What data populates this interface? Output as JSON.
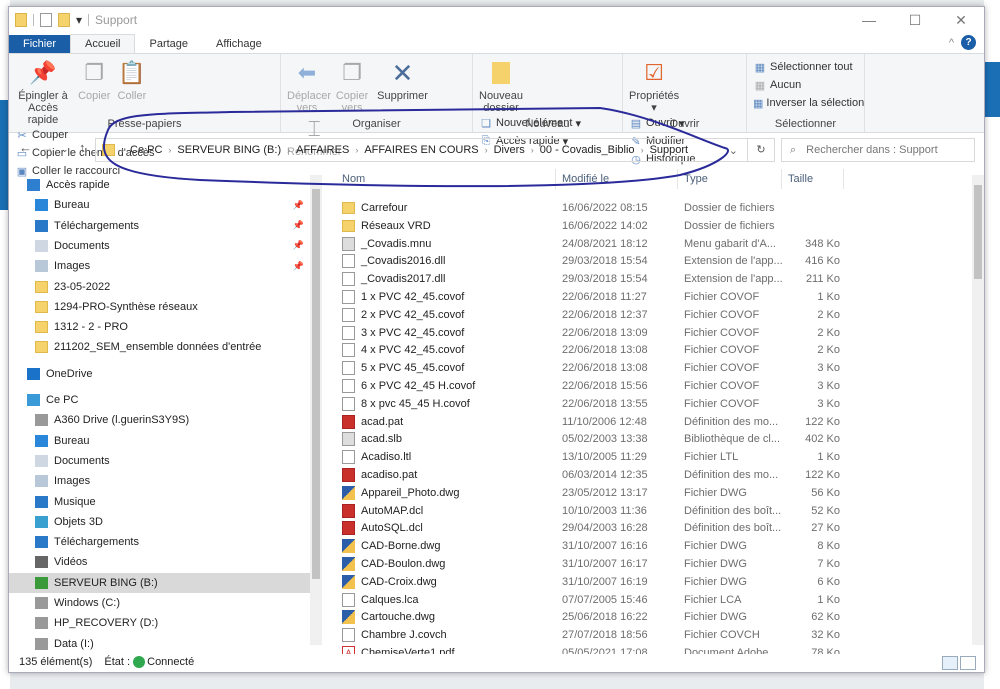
{
  "window": {
    "title": "Support",
    "controls": [
      "minimize",
      "maximize",
      "close"
    ]
  },
  "tabs": [
    "Fichier",
    "Accueil",
    "Partage",
    "Affichage"
  ],
  "active_tab": "Accueil",
  "ribbon": {
    "clipboard": {
      "label": "Presse-papiers",
      "pin": "Épingler à Accès rapide",
      "copy": "Copier",
      "paste": "Coller",
      "cut": "Couper",
      "copy_path": "Copier le chemin d'accès",
      "paste_shortcut": "Coller le raccourci"
    },
    "organize": {
      "label": "Organiser",
      "move": "Déplacer vers",
      "copy_to": "Copier vers",
      "delete": "Supprimer",
      "rename": "Renommer"
    },
    "new": {
      "label": "Nouveau",
      "new_folder": "Nouveau dossier",
      "new_item": "Nouvel élément",
      "easy_access": "Accès rapide"
    },
    "open": {
      "label": "Ouvrir",
      "properties": "Propriétés",
      "open": "Ouvrir",
      "edit": "Modifier",
      "history": "Historique"
    },
    "select": {
      "label": "Sélectionner",
      "all": "Sélectionner tout",
      "none": "Aucun",
      "invert": "Inverser la sélection"
    }
  },
  "address": {
    "crumbs": [
      "Ce PC",
      "SERVEUR BING (B:)",
      "AFFAIRES",
      "AFFAIRES EN COURS",
      "Divers",
      "00 - Covadis_Biblio",
      "Support"
    ],
    "search_placeholder": "Rechercher dans : Support"
  },
  "nav": [
    {
      "label": "Accès rapide",
      "icon": "star-icon",
      "level": 0
    },
    {
      "label": "Bureau",
      "icon": "desktop-icon",
      "level": 1,
      "pinned": true
    },
    {
      "label": "Téléchargements",
      "icon": "download-icon",
      "level": 1,
      "pinned": true
    },
    {
      "label": "Documents",
      "icon": "documents-icon",
      "level": 1,
      "pinned": true
    },
    {
      "label": "Images",
      "icon": "images-icon",
      "level": 1,
      "pinned": true
    },
    {
      "label": "23-05-2022",
      "icon": "folder-icon",
      "level": 1
    },
    {
      "label": "1294-PRO-Synthèse réseaux",
      "icon": "folder-icon",
      "level": 1
    },
    {
      "label": "1312 - 2 - PRO",
      "icon": "folder-icon",
      "level": 1
    },
    {
      "label": "211202_SEM_ensemble données d'entrée",
      "icon": "folder-icon",
      "level": 1
    },
    {
      "label": "OneDrive",
      "icon": "cloud-icon",
      "level": 0
    },
    {
      "label": "Ce PC",
      "icon": "pc-icon",
      "level": 0
    },
    {
      "label": "A360 Drive (l.guerinS3Y9S)",
      "icon": "drive-icon",
      "level": 1
    },
    {
      "label": "Bureau",
      "icon": "desktop-icon",
      "level": 1
    },
    {
      "label": "Documents",
      "icon": "documents-icon",
      "level": 1
    },
    {
      "label": "Images",
      "icon": "images-icon",
      "level": 1
    },
    {
      "label": "Musique",
      "icon": "music-icon",
      "level": 1
    },
    {
      "label": "Objets 3D",
      "icon": "3d-objects-icon",
      "level": 1
    },
    {
      "label": "Téléchargements",
      "icon": "download-icon",
      "level": 1
    },
    {
      "label": "Vidéos",
      "icon": "video-icon",
      "level": 1
    },
    {
      "label": "SERVEUR BING (B:)",
      "icon": "network-drive-icon",
      "level": 1,
      "selected": true
    },
    {
      "label": "Windows  (C:)",
      "icon": "drive-icon",
      "level": 1
    },
    {
      "label": "HP_RECOVERY (D:)",
      "icon": "drive-icon",
      "level": 1
    },
    {
      "label": "Data (I:)",
      "icon": "drive-icon",
      "level": 1
    }
  ],
  "columns": [
    "Nom",
    "Modifié le",
    "Type",
    "Taille"
  ],
  "files": [
    {
      "name": "Carrefour",
      "date": "16/06/2022 08:15",
      "type": "Dossier de fichiers",
      "size": "",
      "icon": "folder"
    },
    {
      "name": "Réseaux VRD",
      "date": "16/06/2022 14:02",
      "type": "Dossier de fichiers",
      "size": "",
      "icon": "folder"
    },
    {
      "name": "_Covadis.mnu",
      "date": "24/08/2021 18:12",
      "type": "Menu gabarit d'A...",
      "size": "348 Ko",
      "icon": "gray"
    },
    {
      "name": "_Covadis2016.dll",
      "date": "29/03/2018 15:54",
      "type": "Extension de l'app...",
      "size": "416 Ko",
      "icon": "file"
    },
    {
      "name": "_Covadis2017.dll",
      "date": "29/03/2018 15:54",
      "type": "Extension de l'app...",
      "size": "211 Ko",
      "icon": "file"
    },
    {
      "name": "1 x PVC 42_45.covof",
      "date": "22/06/2018 11:27",
      "type": "Fichier COVOF",
      "size": "1 Ko",
      "icon": "file"
    },
    {
      "name": "2 x PVC 42_45.covof",
      "date": "22/06/2018 12:37",
      "type": "Fichier COVOF",
      "size": "2 Ko",
      "icon": "file"
    },
    {
      "name": "3 x PVC 42_45.covof",
      "date": "22/06/2018 13:09",
      "type": "Fichier COVOF",
      "size": "2 Ko",
      "icon": "file"
    },
    {
      "name": "4 x PVC 42_45.covof",
      "date": "22/06/2018 13:08",
      "type": "Fichier COVOF",
      "size": "2 Ko",
      "icon": "file"
    },
    {
      "name": "5 x PVC 45_45.covof",
      "date": "22/06/2018 13:08",
      "type": "Fichier COVOF",
      "size": "3 Ko",
      "icon": "file"
    },
    {
      "name": "6 x PVC 42_45 H.covof",
      "date": "22/06/2018 15:56",
      "type": "Fichier COVOF",
      "size": "3 Ko",
      "icon": "file"
    },
    {
      "name": "8 x pvc 45_45 H.covof",
      "date": "22/06/2018 13:55",
      "type": "Fichier COVOF",
      "size": "3 Ko",
      "icon": "file"
    },
    {
      "name": "acad.pat",
      "date": "11/10/2006 12:48",
      "type": "Définition des mo...",
      "size": "122 Ko",
      "icon": "red"
    },
    {
      "name": "acad.slb",
      "date": "05/02/2003 13:38",
      "type": "Bibliothèque de cl...",
      "size": "402 Ko",
      "icon": "gray"
    },
    {
      "name": "Acadiso.ltl",
      "date": "13/10/2005 11:29",
      "type": "Fichier LTL",
      "size": "1 Ko",
      "icon": "file"
    },
    {
      "name": "acadiso.pat",
      "date": "06/03/2014 12:35",
      "type": "Définition des mo...",
      "size": "122 Ko",
      "icon": "red"
    },
    {
      "name": "Appareil_Photo.dwg",
      "date": "23/05/2012 13:17",
      "type": "Fichier DWG",
      "size": "56 Ko",
      "icon": "dwg"
    },
    {
      "name": "AutoMAP.dcl",
      "date": "10/10/2003 11:36",
      "type": "Définition des boît...",
      "size": "52 Ko",
      "icon": "red"
    },
    {
      "name": "AutoSQL.dcl",
      "date": "29/04/2003 16:28",
      "type": "Définition des boît...",
      "size": "27 Ko",
      "icon": "red"
    },
    {
      "name": "CAD-Borne.dwg",
      "date": "31/10/2007 16:16",
      "type": "Fichier DWG",
      "size": "8 Ko",
      "icon": "dwg"
    },
    {
      "name": "CAD-Boulon.dwg",
      "date": "31/10/2007 16:17",
      "type": "Fichier DWG",
      "size": "7 Ko",
      "icon": "dwg"
    },
    {
      "name": "CAD-Croix.dwg",
      "date": "31/10/2007 16:19",
      "type": "Fichier DWG",
      "size": "6 Ko",
      "icon": "dwg"
    },
    {
      "name": "Calques.lca",
      "date": "07/07/2005 15:46",
      "type": "Fichier LCA",
      "size": "1 Ko",
      "icon": "file"
    },
    {
      "name": "Cartouche.dwg",
      "date": "25/06/2018 16:22",
      "type": "Fichier DWG",
      "size": "62 Ko",
      "icon": "dwg"
    },
    {
      "name": "Chambre J.covch",
      "date": "27/07/2018 18:56",
      "type": "Fichier COVCH",
      "size": "32 Ko",
      "icon": "file"
    },
    {
      "name": "ChemiseVerte1.pdf",
      "date": "05/05/2021 17:08",
      "type": "Document Adobe ...",
      "size": "78 Ko",
      "icon": "pdf"
    }
  ],
  "status": {
    "count": "135 élément(s)",
    "state_label": "État :",
    "state": "Connecté"
  },
  "colors": {
    "file_tab": "#1a5ea8",
    "annotation": "#2a2a9a",
    "selected_nav": "#d9d9d9"
  }
}
